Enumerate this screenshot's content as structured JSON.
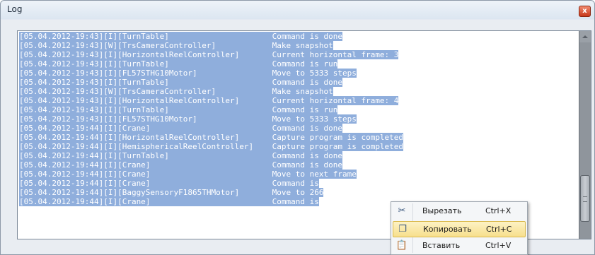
{
  "window": {
    "title": "Log",
    "close_glyph": "x"
  },
  "log": {
    "lines": [
      "[05.04.2012-19:43][I][TurnTable]                      Command is done",
      "[05.04.2012-19:43][W][TrsCameraController]            Make snapshot",
      "[05.04.2012-19:43][I][HorizontalReelController]       Current horizontal frame: 3",
      "[05.04.2012-19:43][I][TurnTable]                      Command is run",
      "[05.04.2012-19:43][I][FL57STHG10Motor]                Move to 5333 steps",
      "[05.04.2012-19:43][I][TurnTable]                      Command is done",
      "[05.04.2012-19:43][W][TrsCameraController]            Make snapshot",
      "[05.04.2012-19:43][I][HorizontalReelController]       Current horizontal frame: 4",
      "[05.04.2012-19:43][I][TurnTable]                      Command is run",
      "[05.04.2012-19:43][I][FL57STHG10Motor]                Move to 5333 steps",
      "[05.04.2012-19:44][I][Crane]                          Command is done",
      "[05.04.2012-19:44][I][HorizontalReelController]       Capture program is completed",
      "[05.04.2012-19:44][I][HemisphericalReelController]    Capture program is completed",
      "[05.04.2012-19:44][I][TurnTable]                      Command is done",
      "[05.04.2012-19:44][I][Crane]                          Command is done",
      "[05.04.2012-19:44][I][Crane]                          Move to next frame",
      "[05.04.2012-19:44][I][Crane]                          Command is",
      "[05.04.2012-19:44][I][BaggySensoryF1865THMotor]       Move to 266",
      "[05.04.2012-19:44][I][Crane]                          Command is"
    ]
  },
  "context_menu": {
    "items": [
      {
        "label": "Вырезать",
        "shortcut": "Ctrl+X",
        "icon": "scissors-icon",
        "glyph": "✂"
      },
      {
        "label": "Копировать",
        "shortcut": "Ctrl+C",
        "icon": "copy-icon",
        "glyph": "❐"
      },
      {
        "label": "Вставить",
        "shortcut": "Ctrl+V",
        "icon": "paste-icon",
        "glyph": "📋"
      }
    ]
  },
  "colors": {
    "selection": "#8faedc",
    "menu_highlight": "#f7df8c",
    "close_button": "#c7381a"
  }
}
